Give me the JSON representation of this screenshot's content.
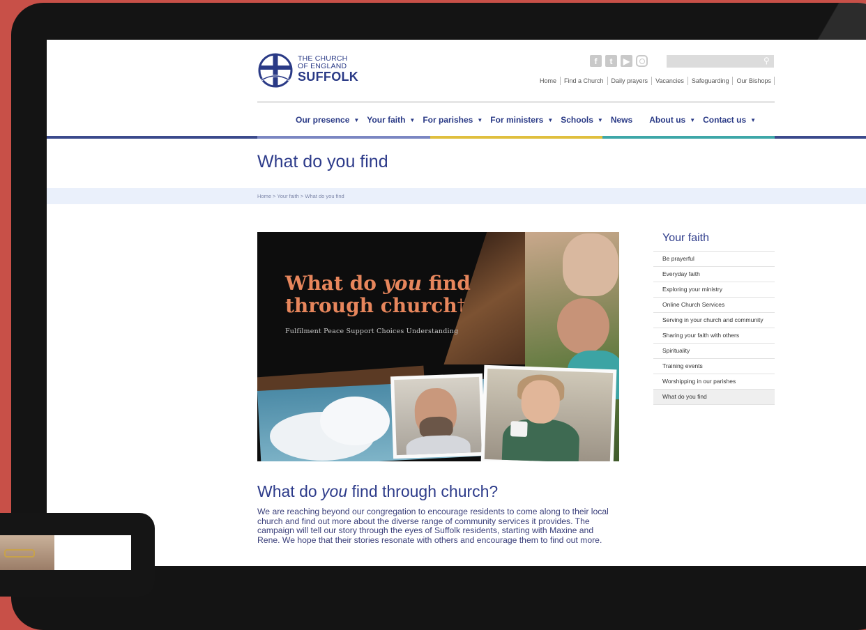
{
  "logo": {
    "line1": "THE CHURCH",
    "line2": "OF ENGLAND",
    "line3": "SUFFOLK"
  },
  "social": [
    {
      "icon": "facebook-icon",
      "glyph": "f"
    },
    {
      "icon": "twitter-icon",
      "glyph": "t"
    },
    {
      "icon": "youtube-icon",
      "glyph": "▶"
    },
    {
      "icon": "instagram-icon",
      "glyph": ""
    }
  ],
  "search": {
    "placeholder": ""
  },
  "top_links": [
    "Home",
    "Find a Church",
    "Daily prayers",
    "Vacancies",
    "Safeguarding",
    "Our Bishops"
  ],
  "main_nav": [
    {
      "label": "Our presence",
      "dropdown": true
    },
    {
      "label": "Your faith",
      "dropdown": true
    },
    {
      "label": "For parishes",
      "dropdown": true
    },
    {
      "label": "For ministers",
      "dropdown": true
    },
    {
      "label": "Schools",
      "dropdown": true
    },
    {
      "label": "News",
      "dropdown": false
    },
    {
      "label": "About us",
      "dropdown": true
    },
    {
      "label": "Contact us",
      "dropdown": true
    }
  ],
  "colors": {
    "bar": [
      "#3b4a8c",
      "#7b86c2",
      "#e0bf3e",
      "#3ea7a8",
      "#3b4a8c"
    ],
    "brand_blue": "#2d3b8a"
  },
  "page_title": "What do you find",
  "breadcrumb": "Home > Your faith > What do you find",
  "hero": {
    "headline_a": "What do ",
    "headline_em": "you",
    "headline_b": " find",
    "headline_c": "through church",
    "cross": "†",
    "tagline": "Fulfilment  Peace  Support  Choices  Understanding"
  },
  "sidebar": {
    "title": "Your faith",
    "items": [
      "Be prayerful",
      "Everyday faith",
      "Exploring your ministry",
      "Online Church Services",
      "Serving in your church and community",
      "Sharing your faith with others",
      "Spirituality",
      "Training events",
      "Worshipping in our parishes",
      "What do you find"
    ],
    "active_index": 9
  },
  "section": {
    "title_a": "What do ",
    "title_em": "you",
    "title_b": " find through church?",
    "body": "We are reaching beyond our congregation to encourage residents to come along to their local church and find out more about the diverse range of community services it provides. The campaign will tell our story through the eyes of Suffolk residents, starting with Maxine and Rene. We hope that their stories resonate with others and encourage them to find out more."
  }
}
